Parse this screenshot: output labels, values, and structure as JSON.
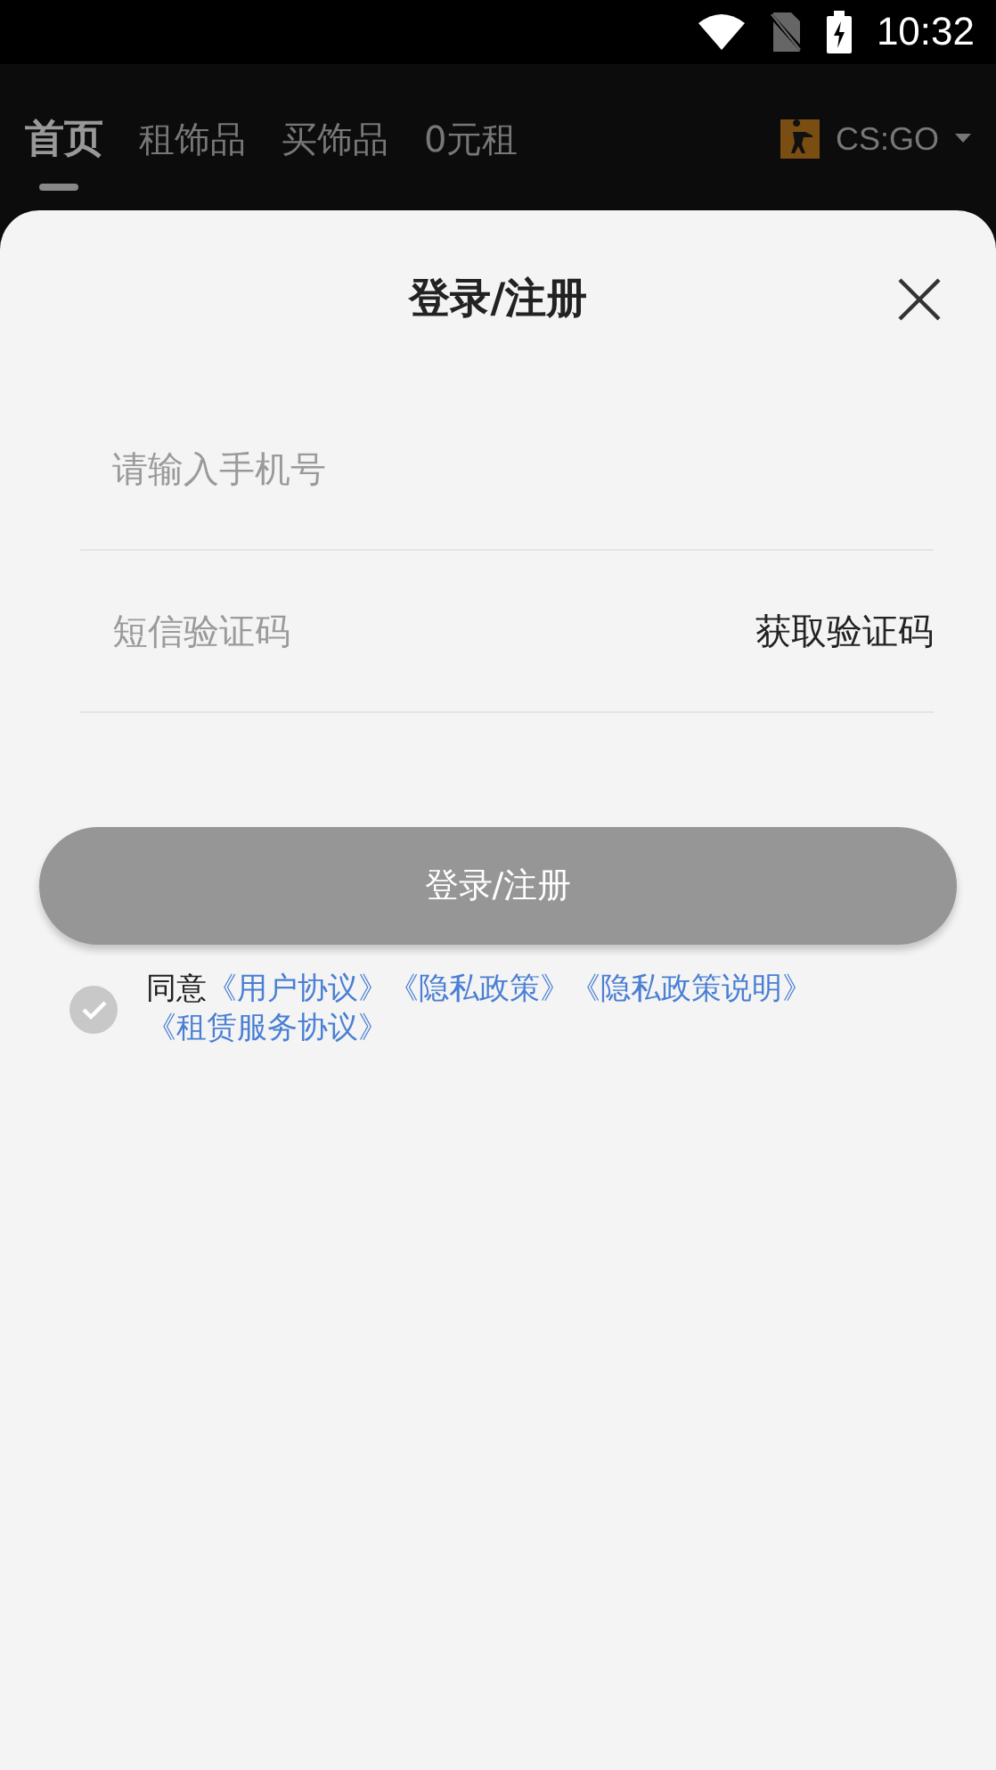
{
  "status_bar": {
    "time": "10:32"
  },
  "tabs": [
    {
      "label": "首页",
      "selected": true
    },
    {
      "label": "租饰品",
      "selected": false
    },
    {
      "label": "买饰品",
      "selected": false
    },
    {
      "label": "0元租",
      "selected": false
    }
  ],
  "game_selector": {
    "label": "CS:GO"
  },
  "sheet": {
    "title": "登录/注册",
    "phone_field": {
      "placeholder": "请输入手机号"
    },
    "code_field": {
      "placeholder": "短信验证码",
      "action": "获取验证码"
    },
    "submit": {
      "label": "登录/注册",
      "disabled": true
    },
    "agreement": {
      "checked": false,
      "prefix": "同意",
      "links": [
        "《用户协议》",
        "《隐私政策》",
        "《隐私政策说明》",
        "《租赁服务协议》"
      ]
    }
  }
}
